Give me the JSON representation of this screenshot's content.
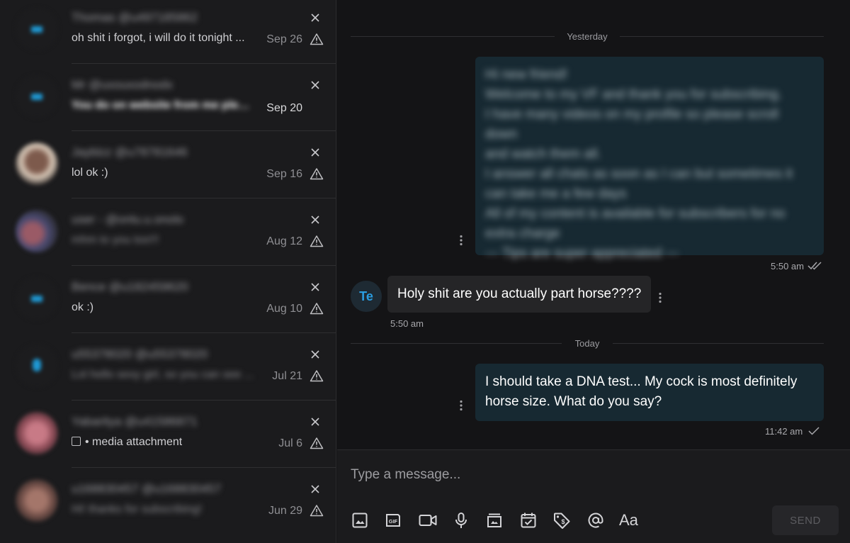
{
  "conversations": [
    {
      "name": "Thomas @u497185862",
      "preview": "oh shit i forgot, i will do it tonight ...",
      "date": "Sep 26",
      "blurred_preview": false,
      "unread": false,
      "avatar": "blue-icon"
    },
    {
      "name": "Mr @uxouxodnodx",
      "preview": "You do on website from me please...",
      "date": "Sep 20",
      "blurred_preview": true,
      "unread": true,
      "avatar": "blue-icon"
    },
    {
      "name": "Jayblzz @u78781646",
      "preview": "lol ok :)",
      "date": "Sep 16",
      "blurred_preview": false,
      "unread": false,
      "avatar": "photo"
    },
    {
      "name": "user - @onlu.u.onolo",
      "preview": "mhm to you too!!!",
      "date": "Aug 12",
      "blurred_preview": true,
      "unread": false,
      "avatar": "photo"
    },
    {
      "name": "Bence @u182459620",
      "preview": "ok :)",
      "date": "Aug 10",
      "blurred_preview": false,
      "unread": false,
      "avatar": "blue-icon"
    },
    {
      "name": "u55378020 @u55378020",
      "preview": "Lol hello sexy girl, so you can see ...",
      "date": "Jul 21",
      "blurred_preview": true,
      "unread": false,
      "avatar": "person-icon"
    },
    {
      "name": "Yabaritya @u41586871",
      "preview": "media attachment",
      "date": "Jul 6",
      "blurred_preview": false,
      "unread": false,
      "avatar": "photo",
      "media": true
    },
    {
      "name": "u168830457 @u168830457",
      "preview": "Hi! thanks for subscribing!",
      "date": "Jun 29",
      "blurred_preview": true,
      "unread": false,
      "avatar": "photo"
    }
  ],
  "chat": {
    "separator_yesterday": "Yesterday",
    "separator_today": "Today",
    "welcome_message_lines": [
      "Hi new friend!",
      "Welcome to my VF and thank you for subscribing.",
      "I have many videos on my profile so please scroll down",
      "and watch them all.",
      "I answer all chats as soon as I can but sometimes it",
      "can take me a few days",
      "All of my content is available for subscribers for no",
      "extra charge",
      "--- Tips are super appreciated ---"
    ],
    "welcome_time": "5:50 am",
    "incoming_avatar_initials": "Te",
    "incoming_message": "Holy shit are you actually part horse????",
    "incoming_time": "5:50 am",
    "reply_message_lines": [
      "I should take a DNA test... My cock is most definitely",
      "horse size. What do you say?"
    ],
    "reply_time": "11:42 am"
  },
  "composer": {
    "placeholder": "Type a message...",
    "send_label": "SEND",
    "tools": [
      "image-icon",
      "gif-icon",
      "video-icon",
      "microphone-icon",
      "vault-icon",
      "schedule-icon",
      "price-tag-icon",
      "mention-icon",
      "text-format-icon"
    ],
    "text_tool_label": "Aa"
  },
  "colors": {
    "outgoing_bubble": "#172932",
    "incoming_bubble": "#252527",
    "accent": "#2a9de0"
  }
}
